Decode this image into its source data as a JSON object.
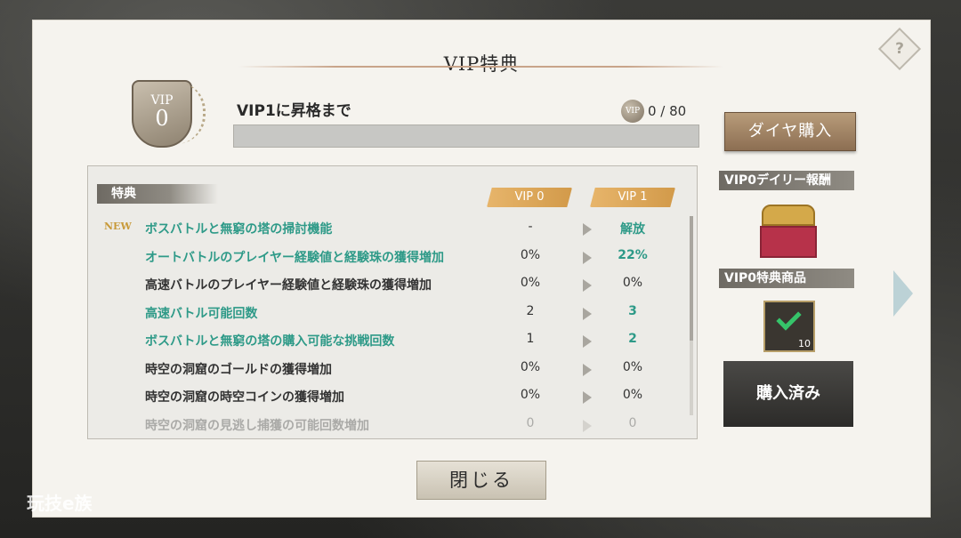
{
  "title": "VIP特典",
  "help_icon": "help-icon",
  "badge": {
    "label": "VIP",
    "level": "0"
  },
  "rank": {
    "label": "VIP1に昇格まで",
    "coin_label": "VIP",
    "points": "0 / 80",
    "progress_fraction": 0
  },
  "buttons": {
    "diamond": "ダイヤ購入",
    "purchased": "購入済み",
    "close": "閉じる"
  },
  "table": {
    "header": "特典",
    "col_current": "VIP 0",
    "col_next": "VIP 1",
    "rows": [
      {
        "tag": "NEW",
        "name": "ボスバトルと無窮の塔の掃討機能",
        "v0": "-",
        "v1": "解放",
        "teal": true
      },
      {
        "tag": "",
        "name": "オートバトルのプレイヤー経験値と経験珠の獲得増加",
        "v0": "0%",
        "v1": "22%",
        "teal": true
      },
      {
        "tag": "",
        "name": "高速バトルのプレイヤー経験値と経験珠の獲得増加",
        "v0": "0%",
        "v1": "0%",
        "teal": false
      },
      {
        "tag": "",
        "name": "高速バトル可能回数",
        "v0": "2",
        "v1": "3",
        "teal": true
      },
      {
        "tag": "",
        "name": "ボスバトルと無窮の塔の購入可能な挑戦回数",
        "v0": "1",
        "v1": "2",
        "teal": true
      },
      {
        "tag": "",
        "name": "時空の洞窟のゴールドの獲得増加",
        "v0": "0%",
        "v1": "0%",
        "teal": false
      },
      {
        "tag": "",
        "name": "時空の洞窟の時空コインの獲得増加",
        "v0": "0%",
        "v1": "0%",
        "teal": false
      },
      {
        "tag": "",
        "name": "時空の洞窟の見逃し捕獲の可能回数増加",
        "v0": "0",
        "v1": "0",
        "teal": false
      }
    ]
  },
  "side": {
    "daily_reward_label": "VIP0デイリー報酬",
    "shop_label": "VIP0特典商品",
    "item_count": "10"
  },
  "watermark": "玩技e族"
}
